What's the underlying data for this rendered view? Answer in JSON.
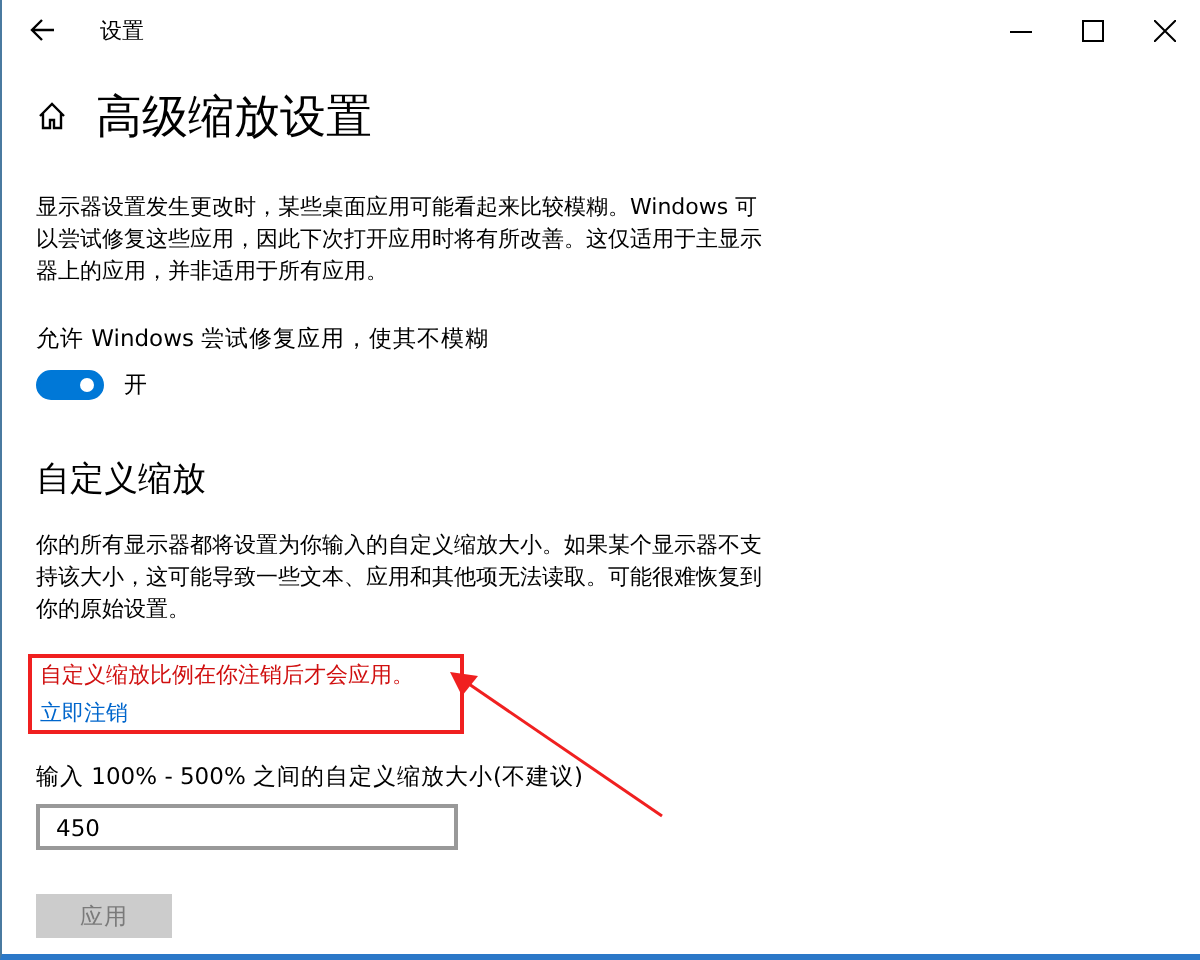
{
  "window": {
    "title": "设置"
  },
  "page": {
    "title": "高级缩放设置"
  },
  "fix_section": {
    "description": "显示器设置发生更改时，某些桌面应用可能看起来比较模糊。Windows 可以尝试修复这些应用，因此下次打开应用时将有所改善。这仅适用于主显示器上的应用，并非适用于所有应用。",
    "toggle_label": "允许 Windows 尝试修复应用，使其不模糊",
    "toggle": {
      "on": true,
      "state_text": "开"
    }
  },
  "custom_section": {
    "heading": "自定义缩放",
    "description": "你的所有显示器都将设置为你输入的自定义缩放大小。如果某个显示器不支持该大小，这可能导致一些文本、应用和其他项无法读取。可能很难恢复到你的原始设置。",
    "notice": "自定义缩放比例在你注销后才会应用。",
    "sign_out_link": "立即注销",
    "input_label": "输入 100% - 500% 之间的自定义缩放大小(不建议)",
    "input_value": "450",
    "apply_button": {
      "label": "应用",
      "disabled": true
    }
  }
}
